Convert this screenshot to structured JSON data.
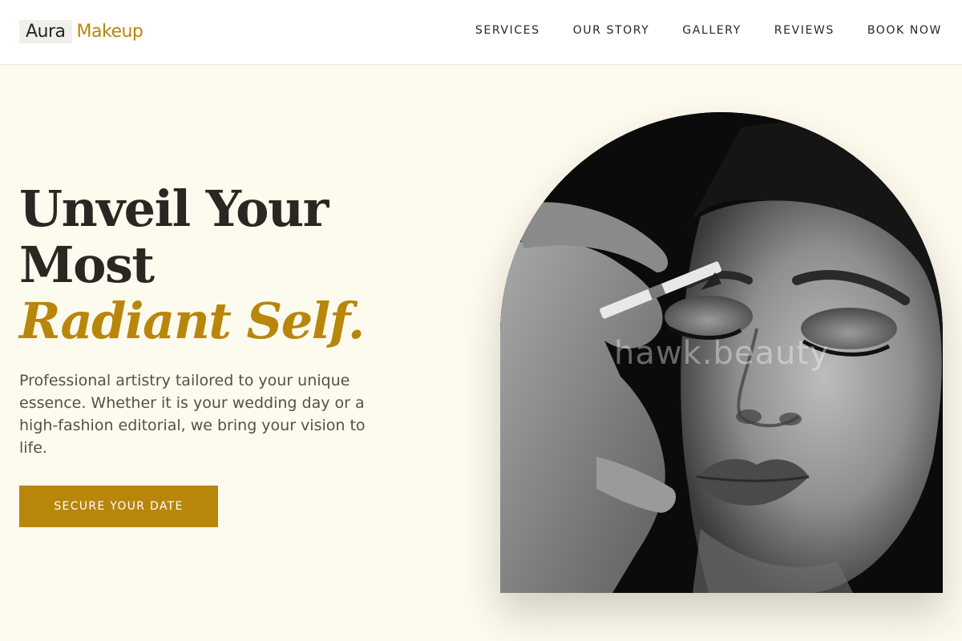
{
  "brand": {
    "name_part1": "Aura",
    "name_part2": "Makeup"
  },
  "nav": {
    "items": [
      {
        "label": "SERVICES"
      },
      {
        "label": "OUR STORY"
      },
      {
        "label": "GALLERY"
      },
      {
        "label": "REVIEWS"
      },
      {
        "label": "BOOK NOW"
      }
    ]
  },
  "hero": {
    "headline_line1": "Unveil Your",
    "headline_line2": "Most",
    "headline_accent": "Radiant Self.",
    "description": "Professional artistry tailored to your unique essence. Whether it is your wedding day or a high-fashion editorial, we bring your vision to life.",
    "cta_label": "SECURE YOUR DATE",
    "image_watermark": "hawk.beauty"
  },
  "colors": {
    "accent": "#b8860b",
    "background": "#fdfaee",
    "text_dark": "#2a2622",
    "text_muted": "#555049"
  },
  "icons": []
}
